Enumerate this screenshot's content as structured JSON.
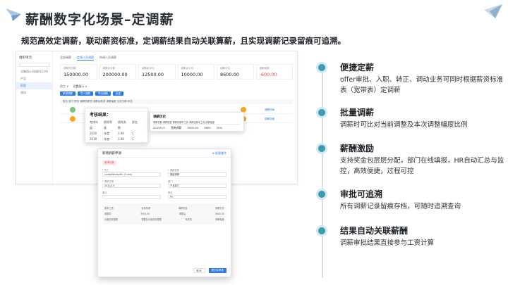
{
  "page": {
    "title": "薪酬数字化场景–定调薪",
    "subtitle": "规范高效定调薪，联动薪资标准，定调薪结果自动关联算薪，且实现调薪记录留痕可追溯。"
  },
  "colors": {
    "accent": "#3a9ab0",
    "brand_blue": "#2c7be5",
    "negative": "#e04a3f"
  },
  "mock": {
    "sidebar": {
      "title": "组织单元",
      "items": [
        "全集团公司组织(234)",
        "产品",
        "研发",
        "测试"
      ]
    },
    "tabs": [
      "全部调薪",
      "定调人员调薪",
      "待调人员调薪"
    ],
    "kpis": [
      {
        "label": "调薪前总额",
        "value": "150000.00"
      },
      {
        "label": "调薪后总额",
        "value": "200000.00"
      },
      {
        "label": "调薪前平均",
        "value": "12500.00"
      },
      {
        "label": "调薪后平均",
        "value": "10000.00"
      },
      {
        "label": "调薪中位",
        "value": "8600.00"
      },
      {
        "label": "调薪差额",
        "value": "-600.00"
      }
    ],
    "toolbar": {
      "left": "员工 ∨",
      "right": "设置展示 ∨"
    },
    "buttons": [
      "新增调薪",
      "导入调薪",
      "导出调薪",
      "批量"
    ],
    "table_header": "姓名    部门    职位    调薪前薪资    调薪后薪资    调整幅度    生效日期    状态",
    "row_links": [
      "调薪档案",
      "调薪档案"
    ],
    "review_popup": {
      "title": "考核结果：",
      "header": [
        "考核年度",
        "绩效等级",
        "绩效系数",
        "排名"
      ],
      "rows": [
        [
          "2020",
          "年度",
          "3.90",
          "C"
        ],
        [
          "2019",
          "年度",
          "3.90",
          "C"
        ]
      ]
    },
    "adjust_popup": {
      "title": "调薪历史",
      "header": "调薪日期  调薪类型  调薪前基本工资  调薪后基本工资  调薪幅度",
      "row": [
        "2019/1/1",
        "宽带调薪",
        "3000.00",
        "3600",
        "20%"
      ]
    },
    "dialog": {
      "title": "新增调薪申请",
      "link": "⊕ 批量操作",
      "tag": "基本信息",
      "fields": [
        {
          "label": "* 员工",
          "value": "Linda(Windy.dh) (3 ons)"
        },
        {
          "label": "* 调薪类型",
          "value": "晋级调薪"
        },
        {
          "label": "* 调薪日期",
          "value": "2021/1/1"
        },
        {
          "label": "部门",
          "value": "产品部门"
        },
        {
          "label": "备注",
          "value": ""
        },
        {
          "label": "职位",
          "value": "P5"
        }
      ],
      "table_rows": [
        [
          "基本工资",
          "目标年薪",
          "调薪项目",
          "调薪方式"
        ],
        [
          "调整前",
          "3000.00",
          "调整后",
          "3600.00"
        ],
        [
          "月度绩效基数",
          "调整后月度绩效基数",
          "年终奖",
          "调薪幅度"
        ]
      ],
      "cancel": "取消",
      "ok": "提交并审批"
    }
  },
  "features": [
    {
      "title": "便捷定薪",
      "desc": "offer审批、入职、转正、调动业务可同时根据薪资标准表（宽带表）定调薪"
    },
    {
      "title": "批量调薪",
      "desc": "调薪时可比对当前调整及本次调整幅度比例"
    },
    {
      "title": "薪酬激励",
      "desc": "支持奖金包层层分配，部门在线填报，HR自动汇总与监控，高效便捷，过程可控"
    },
    {
      "title": "审批可追溯",
      "desc": "所有调薪记录留痕存档，可随时追溯查询"
    },
    {
      "title": "结果自动关联薪酬",
      "desc": "调薪审批结果直接参与工资计算"
    }
  ]
}
